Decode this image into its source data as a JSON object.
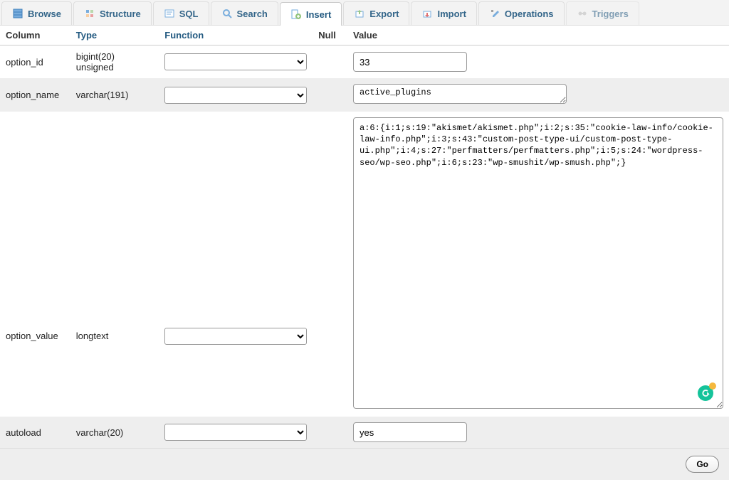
{
  "tabs": [
    {
      "label": "Browse",
      "icon": "browse"
    },
    {
      "label": "Structure",
      "icon": "structure"
    },
    {
      "label": "SQL",
      "icon": "sql"
    },
    {
      "label": "Search",
      "icon": "search"
    },
    {
      "label": "Insert",
      "icon": "insert",
      "active": true
    },
    {
      "label": "Export",
      "icon": "export"
    },
    {
      "label": "Import",
      "icon": "import"
    },
    {
      "label": "Operations",
      "icon": "operations"
    },
    {
      "label": "Triggers",
      "icon": "triggers"
    }
  ],
  "headers": {
    "column": "Column",
    "type": "Type",
    "function": "Function",
    "null": "Null",
    "value": "Value"
  },
  "rows": [
    {
      "column": "option_id",
      "type": "bigint(20) unsigned",
      "value": "33",
      "input": "text"
    },
    {
      "column": "option_name",
      "type": "varchar(191)",
      "value": "active_plugins",
      "input": "textarea-sm"
    },
    {
      "column": "option_value",
      "type": "longtext",
      "value": "a:6:{i:1;s:19:\"akismet/akismet.php\";i:2;s:35:\"cookie-law-info/cookie-law-info.php\";i:3;s:43:\"custom-post-type-ui/custom-post-type-ui.php\";i:4;s:27:\"perfmatters/perfmatters.php\";i:5;s:24:\"wordpress-seo/wp-seo.php\";i:6;s:23:\"wp-smushit/wp-smush.php\";}",
      "input": "textarea-lg"
    },
    {
      "column": "autoload",
      "type": "varchar(20)",
      "value": "yes",
      "input": "text"
    }
  ],
  "go_label": "Go"
}
